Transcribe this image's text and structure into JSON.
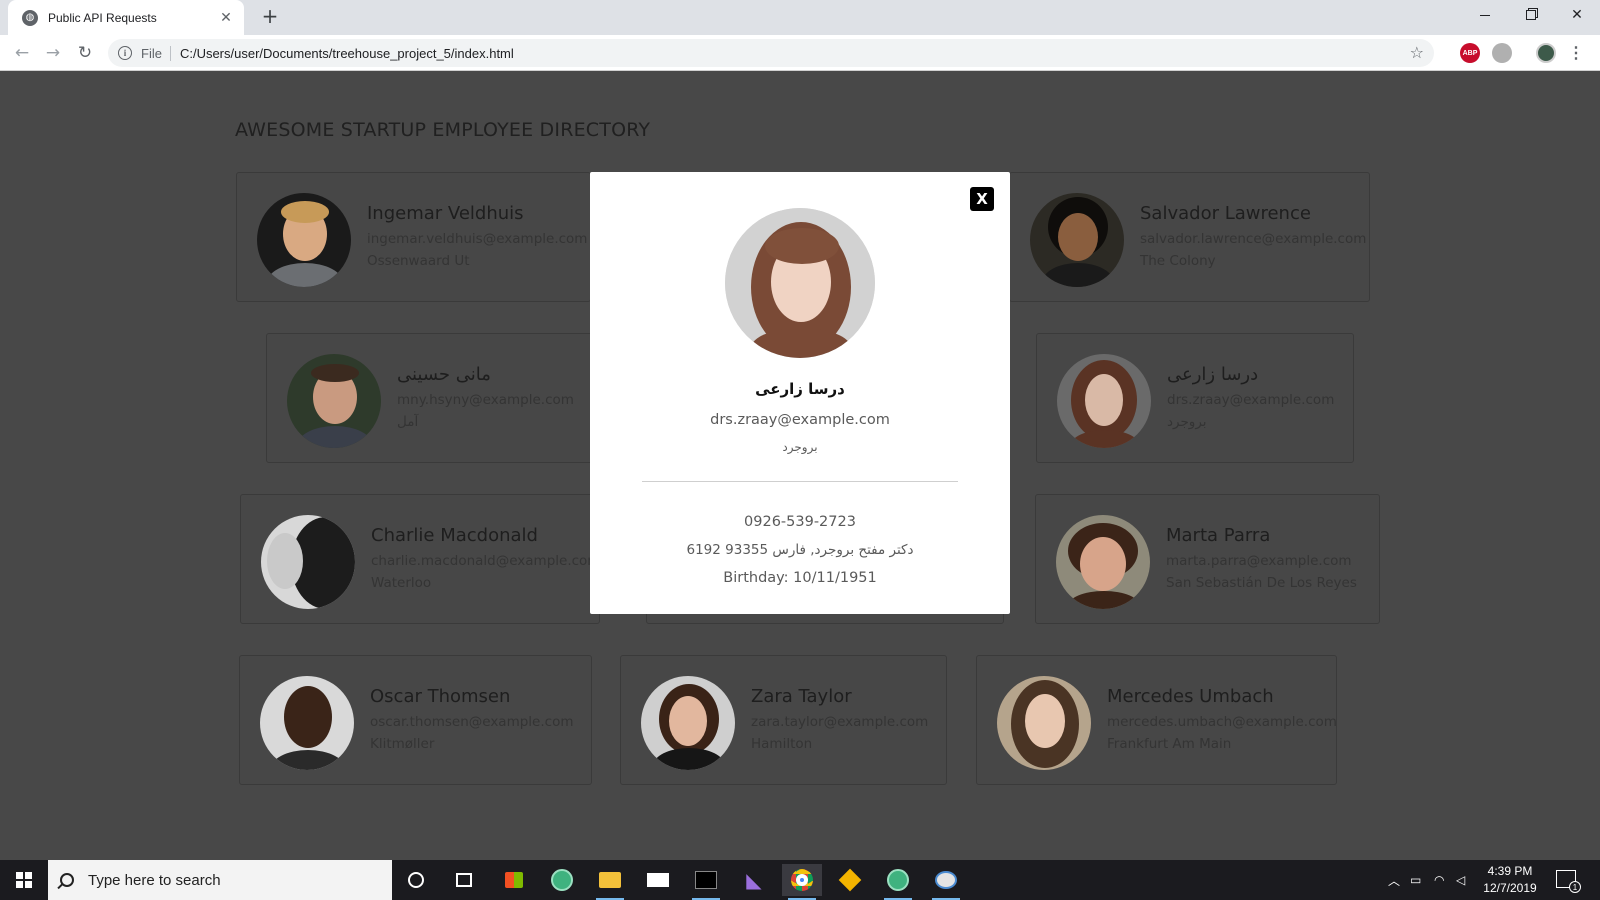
{
  "browser": {
    "tab_title": "Public API Requests",
    "tab_close": "✕",
    "new_tab": "+",
    "url_scheme": "File",
    "url": "C:/Users/user/Documents/treehouse_project_5/index.html",
    "extension_abp": "ABP"
  },
  "page": {
    "title": "AWESOME STARTUP EMPLOYEE DIRECTORY"
  },
  "employees": [
    {
      "name": "Ingemar Veldhuis",
      "email": "ingemar.veldhuis@example.com",
      "city": "Ossenwaard Ut"
    },
    {
      "name": "Salvador Lawrence",
      "email": "salvador.lawrence@example.com",
      "city": "The Colony"
    },
    {
      "name": "مانی حسینی",
      "email": "mny.hsyny@example.com",
      "city": "آمل"
    },
    {
      "name": "درسا زارعی",
      "email": "drs.zraay@example.com",
      "city": "بروجرد"
    },
    {
      "name": "Charlie Macdonald",
      "email": "charlie.macdonald@example.com",
      "city": "Waterloo"
    },
    {
      "name": "Marta Parra",
      "email": "marta.parra@example.com",
      "city": "San Sebastián De Los Reyes"
    },
    {
      "name": "Oscar Thomsen",
      "email": "oscar.thomsen@example.com",
      "city": "Klitmøller"
    },
    {
      "name": "Zara Taylor",
      "email": "zara.taylor@example.com",
      "city": "Hamilton"
    },
    {
      "name": "Mercedes Umbach",
      "email": "mercedes.umbach@example.com",
      "city": "Frankfurt Am Main"
    }
  ],
  "modal": {
    "close_label": "X",
    "name": "درسا زارعی",
    "email": "drs.zraay@example.com",
    "city": "بروجرد",
    "phone": "0926-539-2723",
    "address": "دکتر مفتح بروجرد, فارس 93355 6192",
    "birthday": "Birthday: 10/11/1951"
  },
  "taskbar": {
    "search_placeholder": "Type here to search",
    "time": "4:39 PM",
    "date": "12/7/2019",
    "notification_count": "1"
  }
}
